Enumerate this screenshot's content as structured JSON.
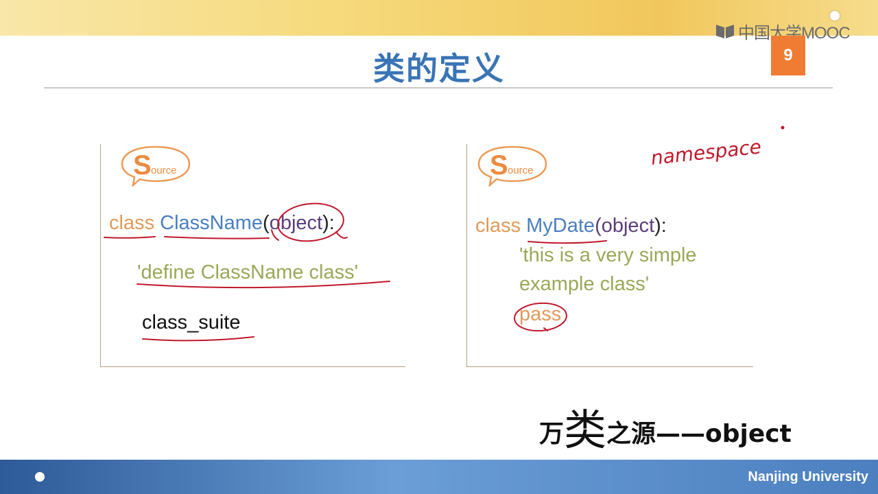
{
  "header": {
    "brand_text": "中国大学MOOC",
    "page_number": "9",
    "title": "类的定义"
  },
  "left_panel": {
    "badge_letter": "S",
    "badge_rest": "ource",
    "line1": {
      "keyword": "class",
      "name": "ClassName",
      "open": "(",
      "base": "object",
      "close": "):"
    },
    "docstring": "'define ClassName class'",
    "suite": "class_suite"
  },
  "right_panel": {
    "badge_letter": "S",
    "badge_rest": "ource",
    "line1": {
      "keyword": "class",
      "name": "MyDate",
      "open": "(",
      "base": "object",
      "close": "):"
    },
    "docstring_line1": "'this is a  very simple",
    "docstring_line2": "example class'",
    "pass_stmt": "pass",
    "handwritten_note": "namespace"
  },
  "slogan": {
    "part1": "万",
    "part2": "类",
    "part3": "之源——object"
  },
  "footer": {
    "university": "Nanjing University"
  },
  "colors": {
    "title": "#3a74b6",
    "page_badge": "#f07c34",
    "keyword": "#e09a5a",
    "class_name": "#4a7fc0",
    "string": "#9aa858",
    "annotation": "#c0182a"
  }
}
